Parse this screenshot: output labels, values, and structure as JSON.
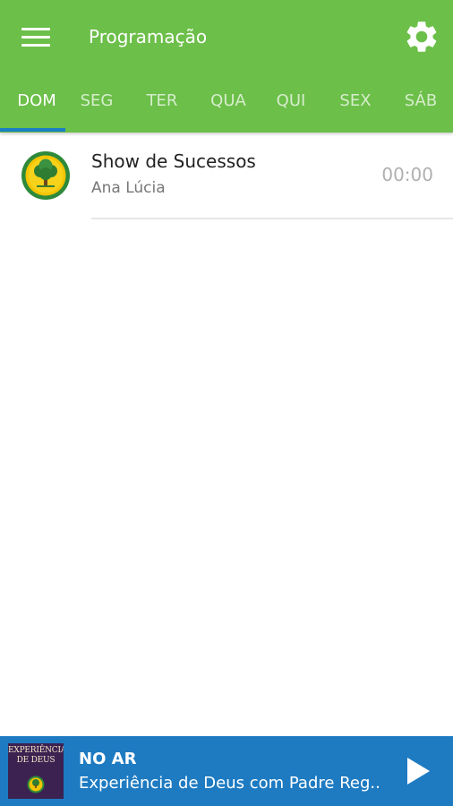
{
  "header": {
    "title": "Programação",
    "menu_icon": "hamburger-menu-icon",
    "settings_icon": "gear-icon",
    "background_color": "#6cbf49"
  },
  "tabs": [
    {
      "label": "DOM",
      "active": true
    },
    {
      "label": "SEG",
      "active": false
    },
    {
      "label": "TER",
      "active": false
    },
    {
      "label": "QUA",
      "active": false
    },
    {
      "label": "QUI",
      "active": false
    },
    {
      "label": "SEX",
      "active": false
    },
    {
      "label": "SÁB",
      "active": false
    }
  ],
  "tab_indicator_color": "#1b7fc4",
  "schedule": [
    {
      "title": "Show de Sucessos",
      "host": "Ana Lúcia",
      "time": "00:00",
      "icon": "station-tree-logo-icon"
    }
  ],
  "player": {
    "label": "NO AR",
    "program": "Experiência de Deus com Padre Reg..",
    "cover_text": [
      "EXPERIÊNCIA",
      "DE DEUS"
    ],
    "play_icon": "play-icon",
    "background_color": "#1e7bc2"
  }
}
